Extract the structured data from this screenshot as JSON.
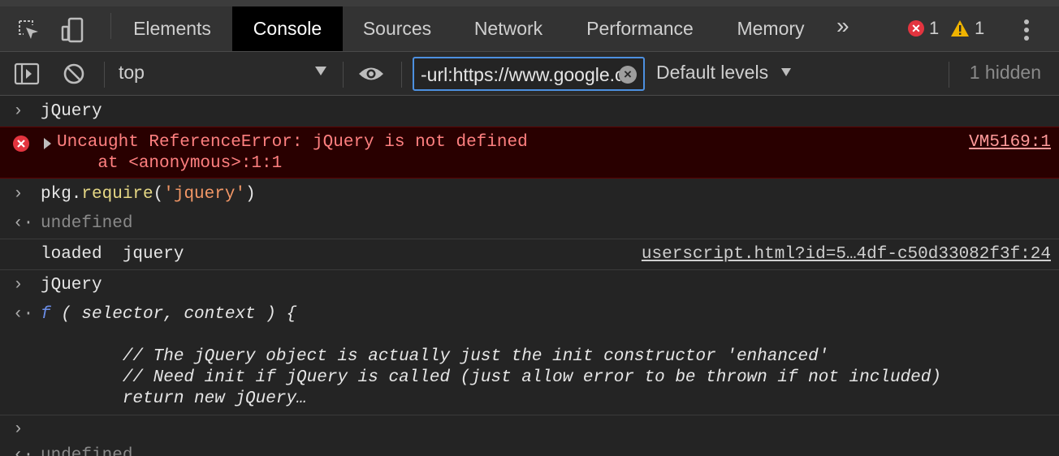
{
  "tabs": [
    "Elements",
    "Console",
    "Sources",
    "Network",
    "Performance",
    "Memory"
  ],
  "more_tabs_glyph": "»",
  "issues": {
    "errors": "1",
    "warnings": "1"
  },
  "toolbar": {
    "context": "top",
    "filter_value": "-url:https://www.google.com",
    "levels": "Default levels",
    "hidden": "1 hidden"
  },
  "console": {
    "entry1_input": "jQuery",
    "error": {
      "message": "Uncaught ReferenceError: jQuery is not defined",
      "stack": "    at <anonymous>:1:1",
      "source": "VM5169:1"
    },
    "entry2": {
      "obj": "pkg.",
      "method": "require",
      "open": "(",
      "arg": "'jquery'",
      "close": ")"
    },
    "entry2_result": "undefined",
    "log": {
      "text": "loaded  jquery",
      "source": "userscript.html?id=5…4df-c50d33082f3f:24"
    },
    "entry3_input": "jQuery",
    "entry3_result": {
      "f": "f",
      "signature": " ( selector, context ) {",
      "line1": "        // The jQuery object is actually just the init constructor 'enhanced'",
      "line2": "        // Need init if jQuery is called (just allow error to be thrown if not included)",
      "line3": "        return new jQuery…"
    },
    "trailing": "undefined"
  }
}
